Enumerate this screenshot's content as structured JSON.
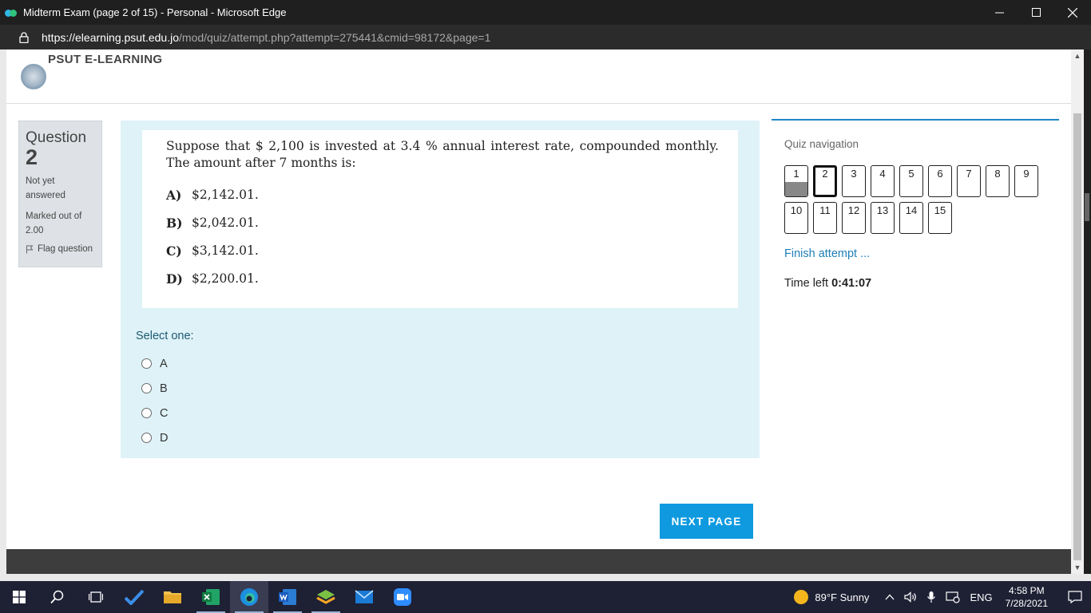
{
  "window": {
    "title": "Midterm Exam (page 2 of 15) - Personal - Microsoft Edge",
    "minimize": "—",
    "maximize": "☐",
    "close": "✕"
  },
  "address": {
    "host": "https://elearning.psut.edu.jo",
    "path": "/mod/quiz/attempt.php?attempt=275441&cmid=98172&page=1"
  },
  "site": {
    "name": "PSUT E-LEARNING"
  },
  "question_info": {
    "label": "Question",
    "number": "2",
    "state": "Not yet answered",
    "marks": "Marked out of 2.00",
    "flag_label": "Flag question"
  },
  "question": {
    "text": "Suppose that $ 2,100 is invested at 3.4 % annual interest rate, compounded monthly. The amount after 7 months is:",
    "choices": [
      {
        "letter": "A)",
        "value": "$2,142.01."
      },
      {
        "letter": "B)",
        "value": "$2,042.01."
      },
      {
        "letter": "C)",
        "value": "$3,142.01."
      },
      {
        "letter": "D)",
        "value": "$2,200.01."
      }
    ],
    "prompt": "Select one:",
    "answers": [
      "A",
      "B",
      "C",
      "D"
    ]
  },
  "next_button": "NEXT PAGE",
  "quiz_nav": {
    "title": "Quiz navigation",
    "buttons": [
      "1",
      "2",
      "3",
      "4",
      "5",
      "6",
      "7",
      "8",
      "9",
      "10",
      "11",
      "12",
      "13",
      "14",
      "15"
    ],
    "answered": [
      1
    ],
    "current": 2,
    "finish_label": "Finish attempt ...",
    "time_label": "Time left",
    "time_value": "0:41:07"
  },
  "taskbar": {
    "weather": "89°F  Sunny",
    "language": "ENG",
    "time": "4:58 PM",
    "date": "7/28/2021"
  }
}
